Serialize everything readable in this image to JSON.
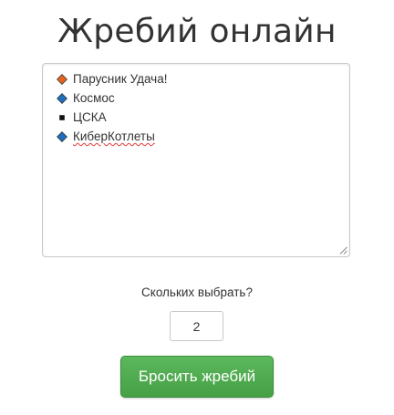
{
  "page": {
    "title": "Жребий онлайн"
  },
  "participants": {
    "items": [
      {
        "text": "Парусник Удача!",
        "icon": "orange-diamond-icon",
        "color": "#e8641e",
        "misspelled": false
      },
      {
        "text": "Космос",
        "icon": "blue-diamond-icon",
        "color": "#1e6ebe",
        "misspelled": false
      },
      {
        "text": "ЦСКА",
        "icon": "black-square-icon",
        "color": "#111111",
        "misspelled": false
      },
      {
        "text": "КиберКотлеты",
        "icon": "blue-diamond-icon",
        "color": "#1e6ebe",
        "misspelled": true
      }
    ]
  },
  "count": {
    "label": "Скольких выбрать?",
    "value": "2"
  },
  "draw_button": {
    "label": "Бросить жребий",
    "color": "#4cae4c"
  }
}
